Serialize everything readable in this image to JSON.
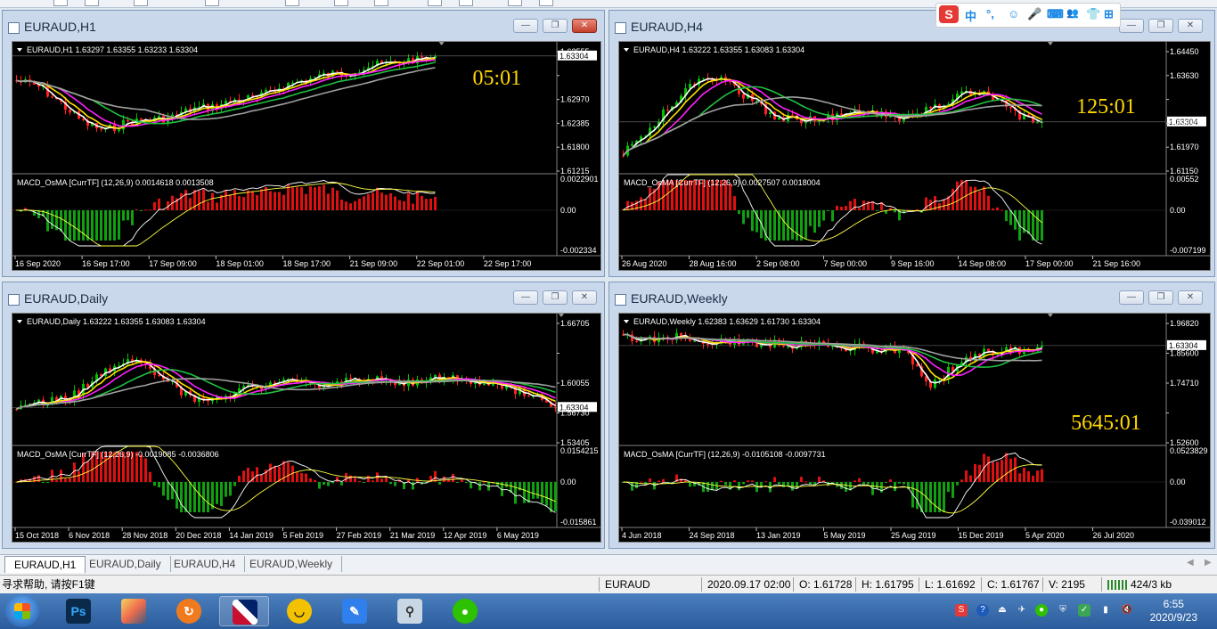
{
  "windows": [
    {
      "id": "h1",
      "title": "EURAUD,H1",
      "info": "EURAUD,H1  1.63297 1.63355 1.63233 1.63304",
      "countdown": "05:01",
      "price_axis": [
        "1.63555",
        "1.63304",
        "1.62970",
        "1.62385",
        "1.61800",
        "1.61215"
      ],
      "macd_title": "MACD_OsMA [CurrTF] (12,26,9) 0.0014618 0.0013508",
      "macd_axis": [
        "0.0022901",
        "0.00",
        "-0.002334"
      ],
      "dates": [
        "16 Sep 2020",
        "16 Sep 17:00",
        "17 Sep 09:00",
        "18 Sep 01:00",
        "18 Sep 17:00",
        "21 Sep 09:00",
        "22 Sep 01:00",
        "22 Sep 17:00"
      ]
    },
    {
      "id": "h4",
      "title": "EURAUD,H4",
      "info": "EURAUD,H4  1.63222 1.63355 1.63083 1.63304",
      "countdown": "125:01",
      "price_axis": [
        "1.64450",
        "1.63630",
        "1.63304",
        "1.62810",
        "1.61970",
        "1.61150"
      ],
      "macd_title": "MACD_OsMA [CurrTF] (12,26,9) 0.0027507 0.0018004",
      "macd_axis": [
        "0.00552",
        "0.00",
        "-0.007199"
      ],
      "dates": [
        "26 Aug 2020",
        "28 Aug 16:00",
        "2 Sep 08:00",
        "7 Sep 00:00",
        "9 Sep 16:00",
        "14 Sep 08:00",
        "17 Sep 00:00",
        "21 Sep 16:00"
      ]
    },
    {
      "id": "daily",
      "title": "EURAUD,Daily",
      "info": "EURAUD,Daily  1.63222 1.63355 1.63083 1.63304",
      "countdown": "",
      "price_axis": [
        "1.66705",
        "1.63304",
        "1.60055",
        "1.56730",
        "1.53405"
      ],
      "macd_title": "MACD_OsMA [CurrTF] (12,26,9) -0.0019085 -0.0036806",
      "macd_axis": [
        "0.0154215",
        "0.00",
        "-0.015861"
      ],
      "dates": [
        "15 Oct 2018",
        "6 Nov 2018",
        "28 Nov 2018",
        "20 Dec 2018",
        "14 Jan 2019",
        "5 Feb 2019",
        "27 Feb 2019",
        "21 Mar 2019",
        "12 Apr 2019",
        "6 May 2019"
      ]
    },
    {
      "id": "weekly",
      "title": "EURAUD,Weekly",
      "info": "EURAUD,Weekly  1.62383 1.63629 1.61730 1.63304",
      "countdown": "5645:01",
      "price_axis": [
        "1.96820",
        "1.85600",
        "1.74710",
        "1.63304",
        "1.52600"
      ],
      "macd_title": "MACD_OsMA [CurrTF] (12,26,9) -0.0105108 -0.0097731",
      "macd_axis": [
        "0.0523829",
        "0.00",
        "-0.039012"
      ],
      "dates": [
        "4 Jun 2018",
        "24 Sep 2018",
        "13 Jan 2019",
        "5 May 2019",
        "25 Aug 2019",
        "15 Dec 2019",
        "5 Apr 2020",
        "26 Jul 2020"
      ]
    }
  ],
  "tabs": [
    "EURAUD,H1",
    "EURAUD,Daily",
    "EURAUD,H4",
    "EURAUD,Weekly"
  ],
  "status": {
    "help": "寻求帮助, 请按F1键",
    "symbol": "EURAUD",
    "time": "2020.09.17 02:00",
    "open": "O: 1.61728",
    "high": "H: 1.61795",
    "low": "L: 1.61692",
    "close": "C: 1.61767",
    "volume": "V: 2195",
    "traffic": "424/3 kb"
  },
  "clock": {
    "time": "6:55",
    "date": "2020/9/23"
  },
  "ime": [
    "中",
    "°,",
    "☺",
    "🎤",
    "⌨",
    "👕",
    "⊞"
  ],
  "colors": {
    "bull": "#00c000",
    "bear": "#ff2020",
    "ma_white": "#ffffff",
    "ma_yellow": "#ffe000",
    "ma_magenta": "#ff20ff",
    "ma_green": "#20c040",
    "ma_gray": "#a0a0a0",
    "countdown": "#ffd700",
    "macd_up": "#e01010",
    "macd_down": "#10a010"
  }
}
